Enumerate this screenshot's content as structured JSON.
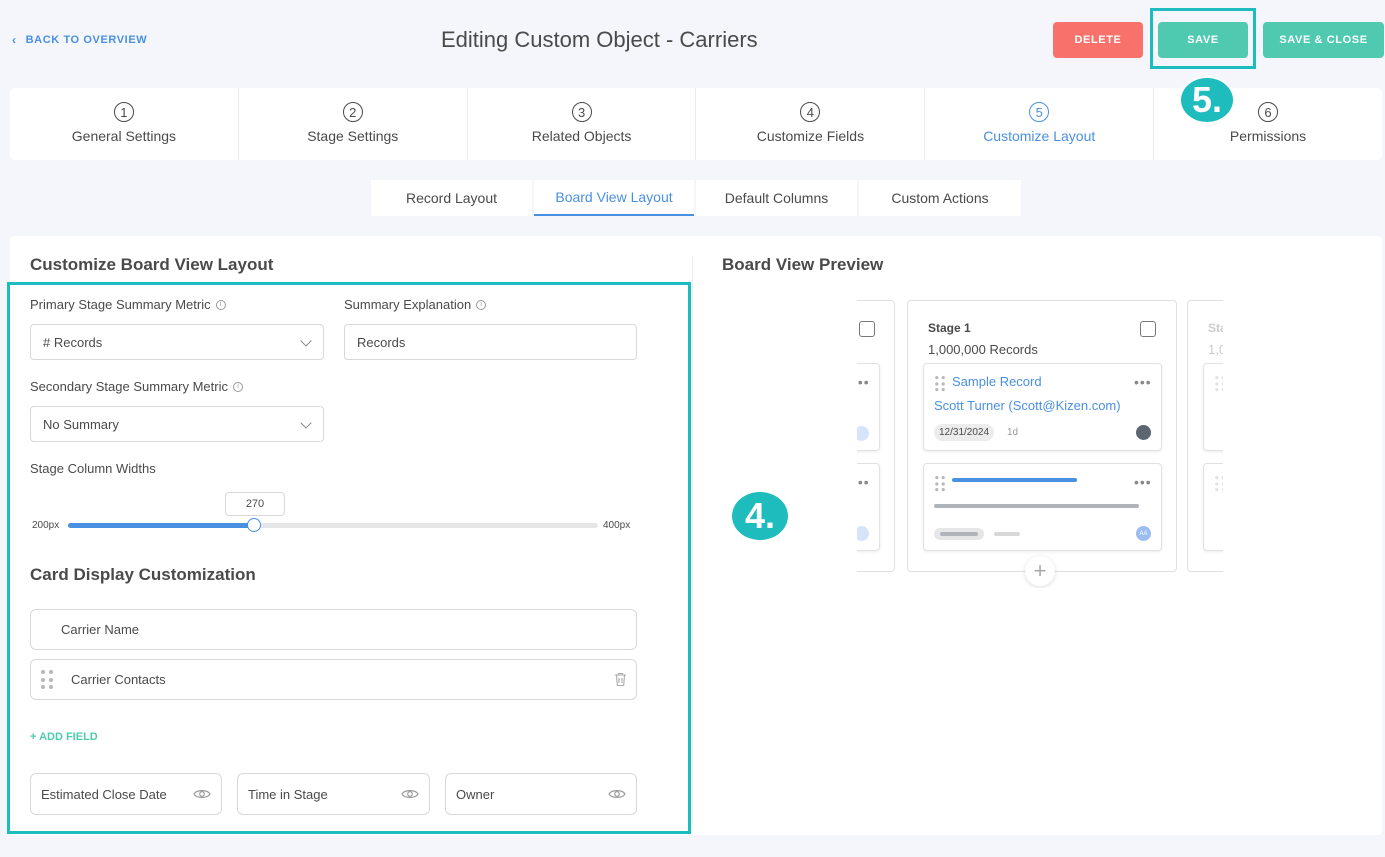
{
  "header": {
    "back_label": "BACK TO OVERVIEW",
    "title": "Editing Custom Object - Carriers",
    "delete_label": "DELETE",
    "save_label": "SAVE",
    "save_close_label": "SAVE & CLOSE"
  },
  "steps": [
    {
      "num": "1",
      "label": "General Settings"
    },
    {
      "num": "2",
      "label": "Stage Settings"
    },
    {
      "num": "3",
      "label": "Related Objects"
    },
    {
      "num": "4",
      "label": "Customize Fields"
    },
    {
      "num": "5",
      "label": "Customize Layout",
      "active": true
    },
    {
      "num": "6",
      "label": "Permissions"
    }
  ],
  "annotations": {
    "badge5": "5.",
    "badge4": "4."
  },
  "subtabs": [
    {
      "label": "Record Layout"
    },
    {
      "label": "Board View Layout",
      "active": true
    },
    {
      "label": "Default Columns"
    },
    {
      "label": "Custom Actions"
    }
  ],
  "form": {
    "section_title": "Customize Board View Layout",
    "primary_label": "Primary Stage Summary Metric",
    "primary_value": "# Records",
    "explanation_label": "Summary Explanation",
    "explanation_value": "Records",
    "secondary_label": "Secondary Stage Summary Metric",
    "secondary_value": "No Summary",
    "widths_label": "Stage Column Widths",
    "slider": {
      "value": "270",
      "min": "200px",
      "max": "400px",
      "fraction": 0.35
    },
    "card_section_title": "Card Display Customization",
    "card_fields": [
      "Carrier Name",
      "Carrier Contacts"
    ],
    "add_field_label": "+ ADD FIELD",
    "footer_fields": [
      "Estimated Close Date",
      "Time in Stage",
      "Owner"
    ]
  },
  "preview": {
    "title": "Board View Preview",
    "stage_title": "Stage 1",
    "stage_count": "1,000,000 Records",
    "record_name": "Sample Record",
    "contact": "Scott Turner (Scott@Kizen.com)",
    "date": "12/31/2024",
    "age": "1d",
    "side_stage_partial": "Sta",
    "side_count_partial": "1,00",
    "avatar_initials": "AA"
  },
  "colors": {
    "accent": "#4a90e2",
    "teal": "#4fc9b0",
    "delete": "#f8716b",
    "highlight": "#1cbcbf"
  }
}
